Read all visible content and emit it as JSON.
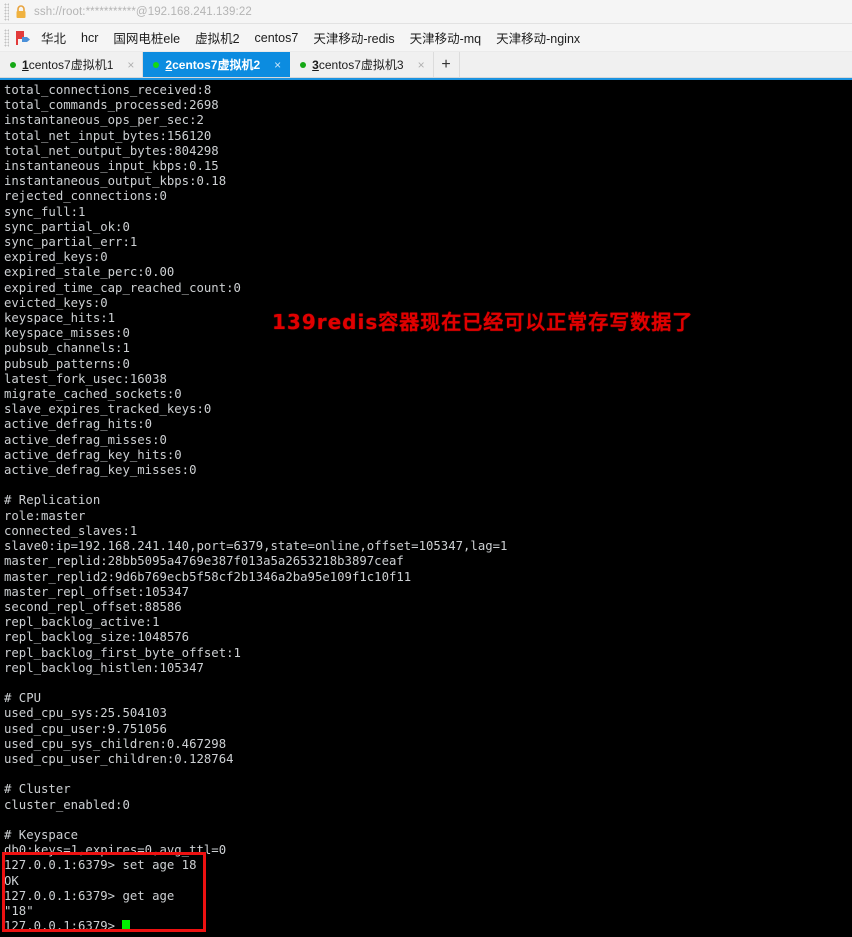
{
  "window": {
    "title": "ssh://root:***********@192.168.241.139:22",
    "lock_icon": "lock-icon"
  },
  "bookmarks": {
    "flag_icon": "flag-icon",
    "items": [
      {
        "label": "华北"
      },
      {
        "label": "hcr"
      },
      {
        "label": "国网电桩ele"
      },
      {
        "label": "虚拟机2"
      },
      {
        "label": "centos7"
      },
      {
        "label": "天津移动-redis"
      },
      {
        "label": "天津移动-mq"
      },
      {
        "label": "天津移动-nginx"
      }
    ]
  },
  "tabs": {
    "new_tab_label": "+",
    "close_label": "×",
    "items": [
      {
        "num": "1",
        "label": "centos7虚拟机1",
        "active": false
      },
      {
        "num": "2",
        "label": "centos7虚拟机2",
        "active": true
      },
      {
        "num": "3",
        "label": "centos7虚拟机3",
        "active": false
      }
    ]
  },
  "terminal": {
    "prompt": "127.0.0.1:6379>",
    "lines": [
      "total_connections_received:8",
      "total_commands_processed:2698",
      "instantaneous_ops_per_sec:2",
      "total_net_input_bytes:156120",
      "total_net_output_bytes:804298",
      "instantaneous_input_kbps:0.15",
      "instantaneous_output_kbps:0.18",
      "rejected_connections:0",
      "sync_full:1",
      "sync_partial_ok:0",
      "sync_partial_err:1",
      "expired_keys:0",
      "expired_stale_perc:0.00",
      "expired_time_cap_reached_count:0",
      "evicted_keys:0",
      "keyspace_hits:1",
      "keyspace_misses:0",
      "pubsub_channels:1",
      "pubsub_patterns:0",
      "latest_fork_usec:16038",
      "migrate_cached_sockets:0",
      "slave_expires_tracked_keys:0",
      "active_defrag_hits:0",
      "active_defrag_misses:0",
      "active_defrag_key_hits:0",
      "active_defrag_key_misses:0",
      "",
      "# Replication",
      "role:master",
      "connected_slaves:1",
      "slave0:ip=192.168.241.140,port=6379,state=online,offset=105347,lag=1",
      "master_replid:28bb5095a4769e387f013a5a2653218b3897ceaf",
      "master_replid2:9d6b769ecb5f58cf2b1346a2ba95e109f1c10f11",
      "master_repl_offset:105347",
      "second_repl_offset:88586",
      "repl_backlog_active:1",
      "repl_backlog_size:1048576",
      "repl_backlog_first_byte_offset:1",
      "repl_backlog_histlen:105347",
      "",
      "# CPU",
      "used_cpu_sys:25.504103",
      "used_cpu_user:9.751056",
      "used_cpu_sys_children:0.467298",
      "used_cpu_user_children:0.128764",
      "",
      "# Cluster",
      "cluster_enabled:0",
      "",
      "# Keyspace",
      "db0:keys=1,expires=0,avg_ttl=0",
      "127.0.0.1:6379> set age 18",
      "OK",
      "127.0.0.1:6379> get age",
      "\"18\"",
      "127.0.0.1:6379> "
    ]
  },
  "annotations": {
    "note_text": "139redis容器现在已经可以正常存写数据了",
    "note_color": "#e00000",
    "highlight_color": "#ee1111"
  }
}
